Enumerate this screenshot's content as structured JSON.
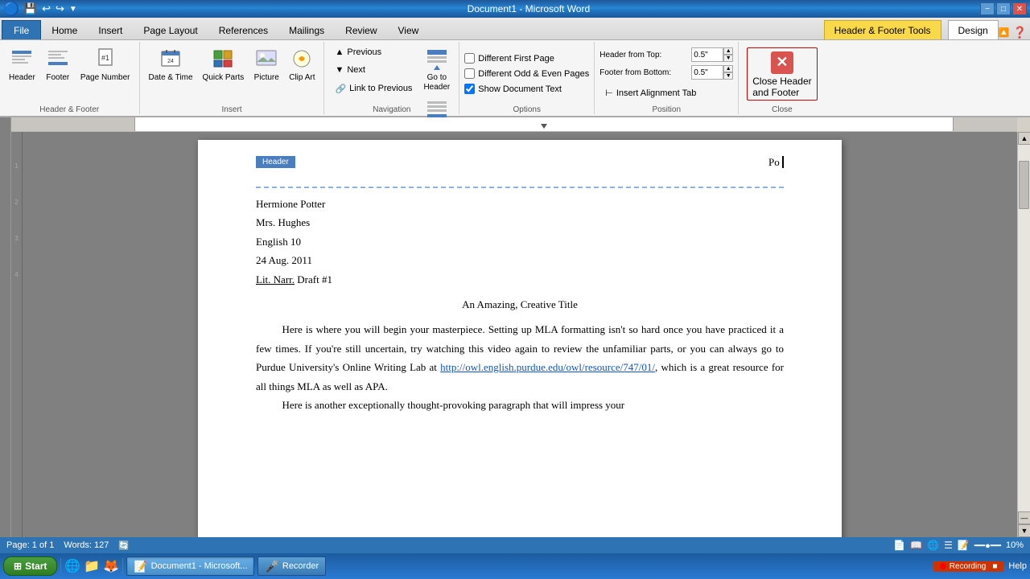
{
  "titlebar": {
    "title": "Document1 - Microsoft Word",
    "minimize": "−",
    "maximize": "□",
    "close": "✕"
  },
  "ribbon": {
    "tabs": [
      "File",
      "Home",
      "Insert",
      "Page Layout",
      "References",
      "Mailings",
      "Review",
      "View",
      "Design"
    ],
    "active_tab": "Design",
    "extra_tab": "Header & Footer Tools",
    "groups": {
      "header_footer": {
        "label": "Header & Footer",
        "buttons": [
          "Header",
          "Footer",
          "Page Number"
        ]
      },
      "insert": {
        "label": "Insert",
        "buttons": [
          "Date & Time",
          "Quick Parts",
          "Picture",
          "Clip Art"
        ]
      },
      "navigation": {
        "label": "Navigation",
        "buttons": [
          "Previous",
          "Next",
          "Go to Header",
          "Go to Footer",
          "Link to Previous"
        ]
      },
      "options": {
        "label": "Options",
        "checkboxes": [
          "Different First Page",
          "Different Odd & Even Pages",
          "Show Document Text"
        ]
      },
      "position": {
        "label": "Position",
        "header_from_top_label": "Header from Top:",
        "header_from_top_value": "0.5\"",
        "footer_from_bottom_label": "Footer from Bottom:",
        "footer_from_bottom_value": "0.5\"",
        "insert_alignment_tab": "Insert Alignment Tab"
      },
      "close": {
        "label": "Close",
        "button": "Close Header and Footer"
      }
    }
  },
  "document": {
    "header_text": "Po",
    "header_label": "Header",
    "author": "Hermione Potter",
    "teacher": "Mrs. Hughes",
    "class": "English 10",
    "date": "24 Aug. 2011",
    "assignment": "Lit. Narr. Draft #1",
    "title": "An Amazing, Creative Title",
    "paragraph1": "Here is where you will begin your masterpiece. Setting up MLA formatting isn't so hard once you have practiced it a few times. If you're still uncertain, try watching this video again to review the unfamiliar parts, or you can always go to Purdue University's Online Writing Lab at ",
    "link": "http://owl.english.purdue.edu/owl/resource/747/01/",
    "paragraph1_end": ", which is a great resource for all things MLA as well as APA.",
    "paragraph2_start": "Here is another exceptionally thought-provoking paragraph that will impress your"
  },
  "statusbar": {
    "page": "Page: 1 of 1",
    "words": "Words: 127",
    "track_changes": "🔄"
  },
  "taskbar": {
    "start": "Start",
    "items": [
      "Document1 - Microsoft..."
    ],
    "recorder": "Recorder",
    "recording": "Recording"
  }
}
